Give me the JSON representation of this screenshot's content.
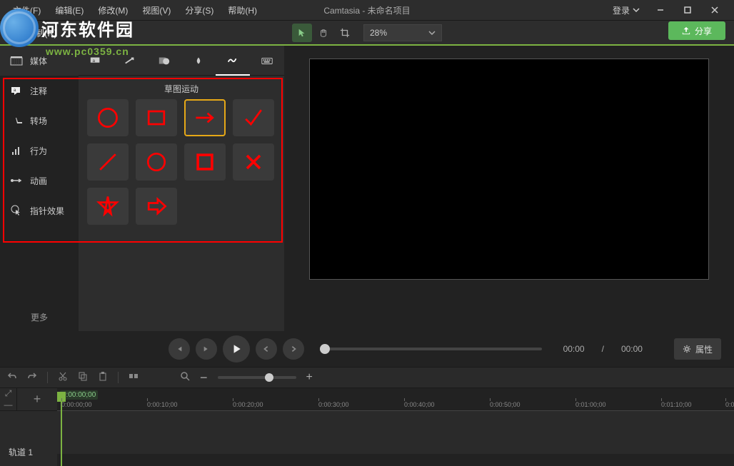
{
  "app": {
    "title": "Camtasia - 未命名项目"
  },
  "menu": {
    "file": "文件(F)",
    "edit": "编辑(E)",
    "modify": "修改(M)",
    "view": "视图(V)",
    "share": "分享(S)",
    "help": "帮助(H)"
  },
  "login": {
    "label": "登录"
  },
  "record": {
    "label": "录制(R)"
  },
  "zoom": {
    "value": "28%"
  },
  "shareBtn": {
    "label": "分享"
  },
  "watermark": {
    "line1": "河东软件园",
    "line2": "www.pc0359.cn"
  },
  "sidebar": {
    "items": [
      {
        "label": "媒体",
        "icon": "media"
      },
      {
        "label": "注释",
        "icon": "annotation"
      },
      {
        "label": "转场",
        "icon": "transition"
      },
      {
        "label": "行为",
        "icon": "behavior"
      },
      {
        "label": "动画",
        "icon": "animation"
      },
      {
        "label": "指针效果",
        "icon": "cursor"
      }
    ],
    "more": "更多"
  },
  "panel": {
    "header": "草图运动",
    "tabs": [
      "callout",
      "arrow",
      "shape",
      "blur",
      "sketch",
      "keystroke"
    ],
    "activeTab": 4,
    "shapes": [
      "circle-outline",
      "square-outline",
      "arrow-right",
      "check",
      "line",
      "circle-outline",
      "square-bold",
      "x",
      "star",
      "arrow-block"
    ],
    "selectedShape": 2
  },
  "player": {
    "currentTime": "00:00",
    "totalTime": "00:00",
    "separator": "/"
  },
  "properties": {
    "label": "属性"
  },
  "timeline": {
    "playheadTime": "0:00:00;00",
    "ticks": [
      "0:00:00;00",
      "0:00:10;00",
      "0:00:20;00",
      "0:00:30;00",
      "0:00:40;00",
      "0:00:50;00",
      "0:01:00;00",
      "0:01:10;00",
      "0:0"
    ],
    "trackLabel": "轨道 1"
  }
}
